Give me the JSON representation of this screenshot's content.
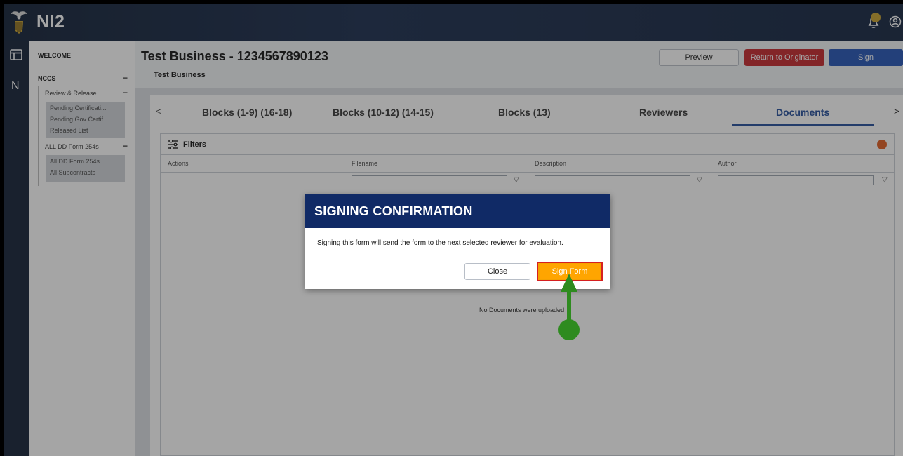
{
  "app": {
    "name": "NI2"
  },
  "sidebar": {
    "welcome": "WELCOME",
    "nccs": "NCCS",
    "minus": "−",
    "review_release": "Review & Release",
    "review_items": [
      "Pending Certificati...",
      "Pending Gov Certif...",
      "Released List"
    ],
    "all_forms": "ALL DD Form 254s",
    "all_items": [
      "All DD Form 254s",
      "All Subcontracts"
    ]
  },
  "rail": {
    "n_label": "N"
  },
  "header": {
    "title": "Test Business - 1234567890123",
    "subtitle": "Test Business",
    "preview": "Preview",
    "return": "Return to Originator",
    "sign": "Sign"
  },
  "tabs": {
    "prev": "<",
    "next": ">",
    "items": [
      "Blocks (1-9) (16-18)",
      "Blocks (10-12) (14-15)",
      "Blocks (13)",
      "Reviewers",
      "Documents"
    ],
    "active": "Documents"
  },
  "grid": {
    "filters_label": "Filters",
    "columns": [
      "Actions",
      "Filename",
      "Description",
      "Author"
    ],
    "empty_message": "No Documents were uploaded"
  },
  "modal": {
    "title": "SIGNING CONFIRMATION",
    "message": "Signing this form will send the form to the next selected reviewer for evaluation.",
    "close": "Close",
    "sign_form": "Sign Form"
  },
  "colors": {
    "brand_navy": "#102a66",
    "sign_blue": "#1f52b5",
    "return_red": "#c42329",
    "sign_form_orange": "#ffa500",
    "annotation_green": "#2e8b1f"
  }
}
